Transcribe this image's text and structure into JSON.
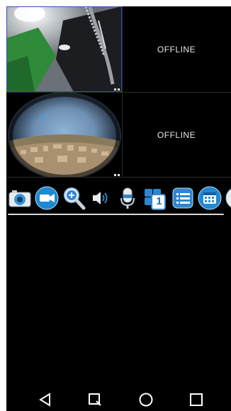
{
  "cameras": [
    {
      "status": "live",
      "scene": "ceiling-cables",
      "active": true
    },
    {
      "status": "offline",
      "label": "OFFLINE"
    },
    {
      "status": "live",
      "scene": "fisheye-city"
    },
    {
      "status": "offline",
      "label": "OFFLINE"
    }
  ],
  "toolbar": {
    "icons": [
      "camera-icon",
      "video-record-icon",
      "zoom-in-icon",
      "speaker-icon",
      "microphone-icon",
      "layout-single-icon",
      "list-icon",
      "calendar-icon",
      "more-icon"
    ],
    "layout_badge": "1",
    "accent": "#1e88d2"
  },
  "navbar": {
    "icons": [
      "back-icon",
      "search-icon",
      "home-icon",
      "recent-apps-icon"
    ]
  }
}
